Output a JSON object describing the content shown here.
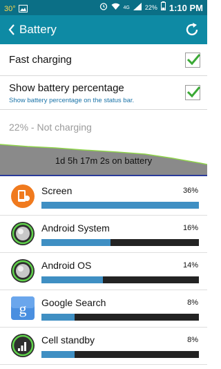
{
  "status_bar": {
    "temperature": "30°",
    "network": "4G",
    "battery_percent": "22%",
    "time": "1:10 PM"
  },
  "app_bar": {
    "title": "Battery",
    "back_icon": "chevron-left-icon",
    "refresh_icon": "refresh-icon"
  },
  "settings": {
    "fast_charging": {
      "label": "Fast charging",
      "checked": true
    },
    "show_percentage": {
      "label": "Show battery percentage",
      "subtitle": "Show battery percentage on the status bar.",
      "checked": true
    }
  },
  "battery_status": "22% - Not charging",
  "graph": {
    "caption": "1d 5h 17m 2s on battery",
    "fill_color": "#8a8a8a",
    "line_color": "#8fd44a"
  },
  "usage": [
    {
      "name": "Screen",
      "percent_label": "36%",
      "level": 1.0,
      "icon": "screen-brightness-icon"
    },
    {
      "name": "Android System",
      "percent_label": "16%",
      "level": 0.44,
      "icon": "android-system-icon"
    },
    {
      "name": "Android OS",
      "percent_label": "14%",
      "level": 0.39,
      "icon": "android-os-icon"
    },
    {
      "name": "Google Search",
      "percent_label": "8%",
      "level": 0.21,
      "icon": "google-search-icon"
    },
    {
      "name": "Cell standby",
      "percent_label": "8%",
      "level": 0.21,
      "icon": "cell-standby-icon"
    }
  ],
  "colors": {
    "status_bar": "#0b6f86",
    "app_bar": "#0e8aa4",
    "bar_fill": "#3f8fc3",
    "bar_track": "#232323",
    "checkmark": "#3aa935"
  }
}
